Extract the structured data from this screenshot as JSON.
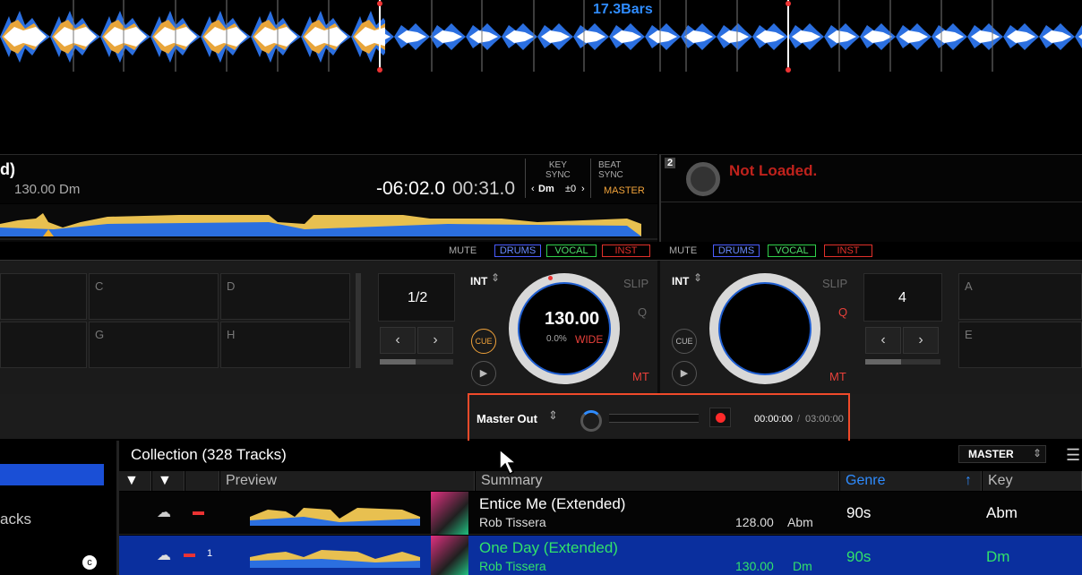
{
  "overview": {
    "bars_label": "17.3Bars"
  },
  "deck1": {
    "title_fragment": "d)",
    "bpm_key": "130.00 Dm",
    "remaining_time": "-06:02.0",
    "elapsed_time": "00:31.0",
    "key_sync_label": "KEY\nSYNC",
    "key_value": "Dm",
    "key_offset": "±0",
    "beat_sync_label": "BEAT\nSYNC",
    "master_label": "MASTER",
    "loop_value": "1/2",
    "jog_bpm": "130.00",
    "jog_pitch": "0.0%",
    "jog_range": "WIDE",
    "int_label": "INT",
    "slip_label": "SLIP",
    "q_label": "Q",
    "mt_label": "MT",
    "cue_label": "CUE",
    "pads": [
      "C",
      "D",
      "G",
      "H"
    ]
  },
  "deck2": {
    "number": "2",
    "status": "Not Loaded.",
    "loop_value": "4",
    "int_label": "INT",
    "slip_label": "SLIP",
    "q_label": "Q",
    "mt_label": "MT",
    "cue_label": "CUE",
    "pads": [
      "A",
      "E"
    ]
  },
  "stems": {
    "mute": "MUTE",
    "drums": "DRUMS",
    "vocal": "VOCAL",
    "inst": "INST"
  },
  "recorder": {
    "source": "Master Out",
    "time_elapsed": "00:00:00",
    "time_separator": "/",
    "time_total": "03:00:00"
  },
  "collection": {
    "title": "Collection (328 Tracks)",
    "output": "MASTER",
    "sidebar_fragment": "acks",
    "columns": {
      "preview": "Preview",
      "summary": "Summary",
      "genre": "Genre",
      "key": "Key"
    },
    "rows": [
      {
        "title": "Entice Me (Extended)",
        "artist": "Rob Tissera",
        "bpm": "128.00",
        "key_small": "Abm",
        "genre": "90s",
        "key": "Abm",
        "badge": ""
      },
      {
        "title": "One Day (Extended)",
        "artist": "Rob Tissera",
        "bpm": "130.00",
        "key_small": "Dm",
        "genre": "90s",
        "key": "Dm",
        "badge": "1"
      }
    ]
  },
  "colors": {
    "accent": "#2f8cff",
    "highlight": "#f04a2a",
    "selected_row": "#0a2f9e",
    "green_text": "#31e26b",
    "mt_red": "#e8403a"
  }
}
